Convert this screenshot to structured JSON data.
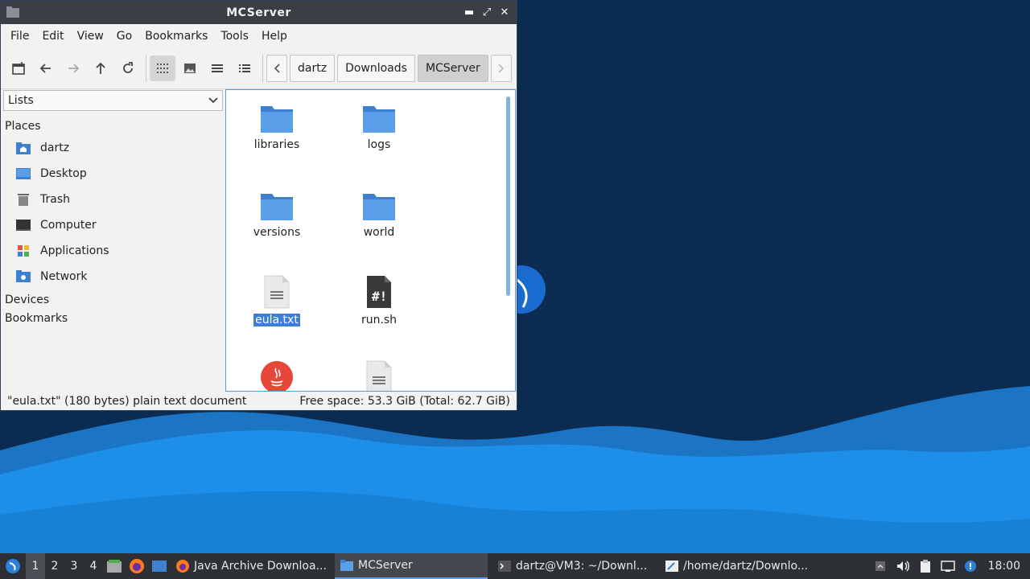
{
  "window": {
    "title": "MCServer",
    "controls": {
      "minimize": "▬",
      "maximize": "⤢",
      "close": "✕"
    }
  },
  "menubar": [
    "File",
    "Edit",
    "View",
    "Go",
    "Bookmarks",
    "Tools",
    "Help"
  ],
  "toolbar": {
    "icons": [
      "new-tab-icon",
      "back-icon",
      "forward-icon",
      "up-icon",
      "reload-icon",
      "icon-view-icon",
      "thumbnail-view-icon",
      "compact-view-icon",
      "detailed-list-icon"
    ],
    "breadcrumb": [
      "dartz",
      "Downloads",
      "MCServer"
    ]
  },
  "sidepane": {
    "select": "Lists",
    "places_header": "Places",
    "places": [
      {
        "label": "dartz",
        "icon": "home-folder-icon"
      },
      {
        "label": "Desktop",
        "icon": "desktop-icon"
      },
      {
        "label": "Trash",
        "icon": "trash-icon"
      },
      {
        "label": "Computer",
        "icon": "computer-icon"
      },
      {
        "label": "Applications",
        "icon": "applications-icon"
      },
      {
        "label": "Network",
        "icon": "network-icon"
      }
    ],
    "devices_header": "Devices",
    "bookmarks_header": "Bookmarks"
  },
  "files": [
    {
      "name": "libraries",
      "type": "folder"
    },
    {
      "name": "logs",
      "type": "folder"
    },
    {
      "name": "versions",
      "type": "folder"
    },
    {
      "name": "world",
      "type": "folder"
    },
    {
      "name": "eula.txt",
      "type": "text",
      "selected": true
    },
    {
      "name": "run.sh",
      "type": "script"
    },
    {
      "name": "",
      "type": "java"
    },
    {
      "name": "",
      "type": "text"
    }
  ],
  "statusbar": {
    "left": "\"eula.txt\" (180 bytes) plain text document",
    "right": "Free space: 53.3 GiB (Total: 62.7 GiB)"
  },
  "taskbar": {
    "workspaces": [
      "1",
      "2",
      "3",
      "4"
    ],
    "tasks": [
      {
        "label": "Java Archive Downloa...",
        "icon": "firefox-icon"
      },
      {
        "label": "MCServer",
        "icon": "folder-icon",
        "active": true
      },
      {
        "label": "dartz@VM3: ~/Downl...",
        "icon": "terminal-icon"
      },
      {
        "label": "/home/dartz/Downlo...",
        "icon": "text-editor-icon"
      }
    ],
    "clock": "18:00"
  },
  "colors": {
    "accent": "#3c7fd6",
    "folder": "#4a8fe0",
    "titlebar": "#3b3f45",
    "taskbar": "#2d3035",
    "desktop_dark": "#0b2a4e",
    "desktop_wave": "#1e8fe8"
  }
}
